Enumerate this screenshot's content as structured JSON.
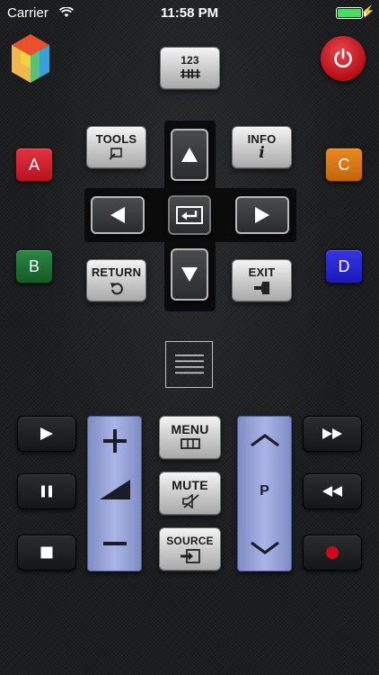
{
  "status_bar": {
    "carrier": "Carrier",
    "time": "11:58 PM"
  },
  "top": {
    "num_button_label": "123",
    "num_button_icon": "keypad-icon",
    "power_icon": "power-icon",
    "app_icon": "app-cube-icon"
  },
  "color_keys": {
    "a": "A",
    "b": "B",
    "c": "C",
    "d": "D",
    "colors": {
      "a": "#c8182c",
      "b": "#1b6b2f",
      "c": "#d27410",
      "d": "#2222cc"
    }
  },
  "function_keys": {
    "tools": "TOOLS",
    "info": "INFO",
    "info_glyph": "i",
    "return": "RETURN",
    "exit": "EXIT"
  },
  "center": {
    "menu_icon": "hamburger-menu-icon"
  },
  "middle_keys": {
    "menu": "MENU",
    "mute": "MUTE",
    "source": "SOURCE"
  },
  "channel": {
    "label": "P"
  },
  "colors": {
    "rocker_blue": "#9aa6dc",
    "record_red": "#d3071c"
  }
}
